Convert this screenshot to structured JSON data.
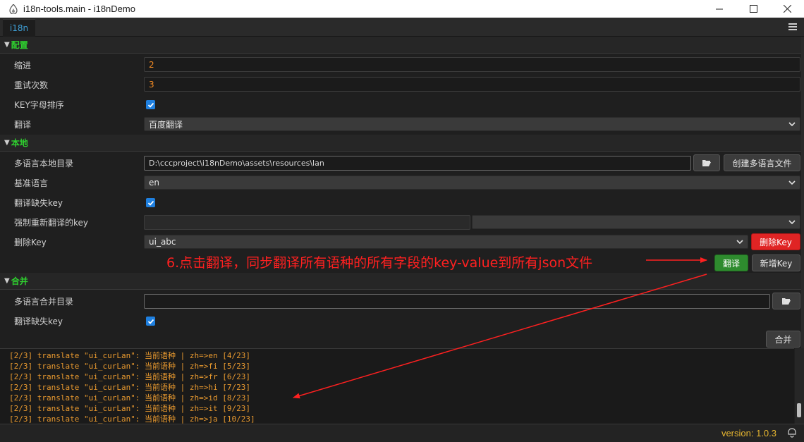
{
  "window": {
    "title": "i18n-tools.main - i18nDemo",
    "controls": [
      "minimize",
      "maximize",
      "close"
    ]
  },
  "tab": {
    "label": "i18n"
  },
  "sections": {
    "config": {
      "title": "配置",
      "indent_label": "缩进",
      "indent_value": "2",
      "retry_label": "重试次数",
      "retry_value": "3",
      "sort_label": "KEY字母排序",
      "sort_checked": true,
      "translate_label": "翻译",
      "translate_value": "百度翻译"
    },
    "local": {
      "title": "本地",
      "dir_label": "多语言本地目录",
      "dir_value": "D:\\cccproject\\i18nDemo\\assets\\resources\\lan",
      "create_button": "创建多语言文件",
      "base_lang_label": "基准语言",
      "base_lang_value": "en",
      "missing_key_label": "翻译缺失key",
      "missing_key_checked": true,
      "force_key_label": "强制重新翻译的key",
      "force_key_value": "",
      "force_key_select": "",
      "delete_key_label": "删除Key",
      "delete_key_value": "ui_abc",
      "delete_key_button": "删除Key",
      "translate_button": "翻译",
      "add_key_button": "新增Key"
    },
    "merge": {
      "title": "合并",
      "dir_label": "多语言合并目录",
      "dir_value": "",
      "missing_key_label": "翻译缺失key",
      "missing_key_checked": true,
      "merge_button": "合并"
    }
  },
  "annotation": {
    "text": "6.点击翻译，同步翻译所有语种的所有字段的key-value到所有json文件",
    "color": "#ff2020"
  },
  "log": {
    "lines": [
      "[2/3] translate \"ui_curLan\": 当前语种 | zh=>en [4/23]",
      "[2/3] translate \"ui_curLan\": 当前语种 | zh=>fi [5/23]",
      "[2/3] translate \"ui_curLan\": 当前语种 | zh=>fr [6/23]",
      "[2/3] translate \"ui_curLan\": 当前语种 | zh=>hi [7/23]",
      "[2/3] translate \"ui_curLan\": 当前语种 | zh=>id [8/23]",
      "[2/3] translate \"ui_curLan\": 当前语种 | zh=>it [9/23]",
      "[2/3] translate \"ui_curLan\": 当前语种 | zh=>ja [10/23]"
    ]
  },
  "footer": {
    "version": "version: 1.0.3"
  },
  "colors": {
    "accent_green": "#2fd02f",
    "log_orange": "#e8992f",
    "version_yellow": "#e8b730",
    "checkbox_blue": "#1f80e0",
    "danger_red": "#e02424",
    "success_green": "#2e8b2e"
  }
}
